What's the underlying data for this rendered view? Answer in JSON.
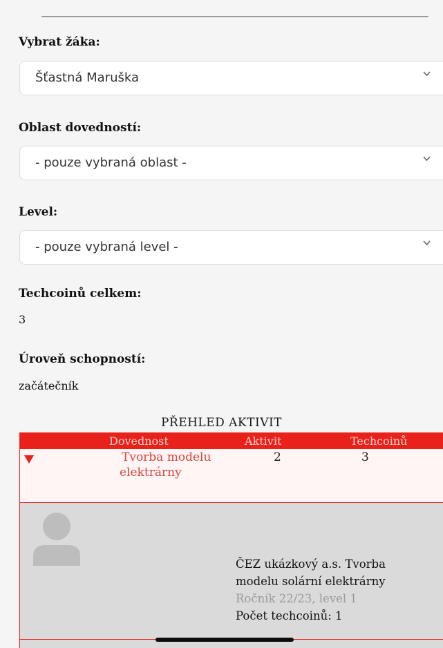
{
  "student_select": {
    "label": "Vybrat žáka:",
    "value": "Šťastná Maruška"
  },
  "skill_area_select": {
    "label": "Oblast dovedností:",
    "value": "- pouze vybraná oblast -"
  },
  "level_select": {
    "label": "Level:",
    "value": "- pouze vybraná level -"
  },
  "techcoins_total": {
    "label": "Techcoinů celkem:",
    "value": "3"
  },
  "skill_level": {
    "label": "Úroveň schopností:",
    "value": "začátečník"
  },
  "overview": {
    "title": "PŘEHLED AKTIVIT",
    "columns": [
      "Dovednost",
      "Aktivit",
      "Techcoinů"
    ],
    "rows": [
      {
        "skill_line1": "Tvorba modelu",
        "skill_line2": "elektrárny",
        "activities": "2",
        "techcoins": "3"
      }
    ],
    "detail": {
      "line1": "ČEZ ukázkový a.s. Tvorba",
      "line2": "modelu solární elektrárny",
      "meta": "Ročník 22/23, level 1",
      "coins": "Počet techcoinů: 1"
    }
  },
  "colors": {
    "accent": "#e8221a",
    "header_text": "#ffd0cc",
    "detail_bg": "#dadada"
  },
  "icons": {
    "dropdown": "chevron-down-icon",
    "expand": "triangle-down-icon",
    "avatar": "user-avatar-icon"
  }
}
